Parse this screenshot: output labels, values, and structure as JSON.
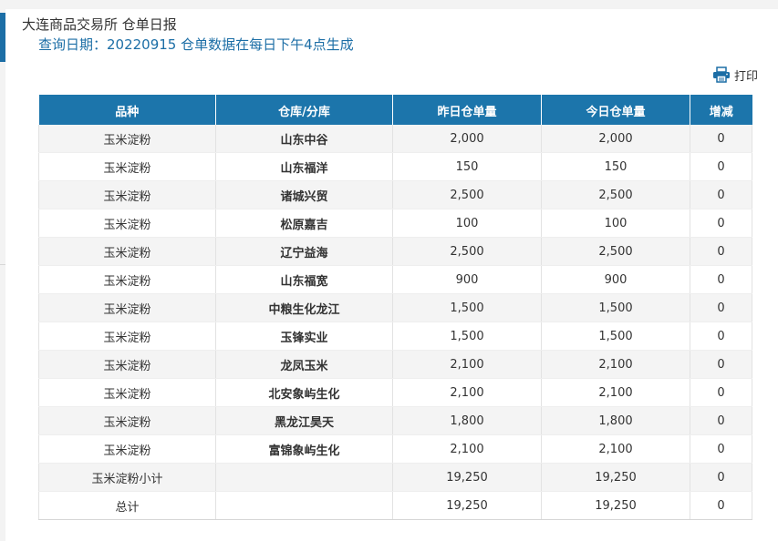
{
  "header": {
    "title": "大连商品交易所 仓单日报",
    "query_line": "查询日期：20220915 仓单数据在每日下午4点生成"
  },
  "toolbar": {
    "print_label": "打印",
    "print_icon": "printer-icon"
  },
  "table": {
    "columns": [
      "品种",
      "仓库/分库",
      "昨日仓单量",
      "今日仓单量",
      "增减"
    ],
    "rows": [
      {
        "variety": "玉米淀粉",
        "warehouse": "山东中谷",
        "yesterday": "2,000",
        "today": "2,000",
        "change": "0"
      },
      {
        "variety": "玉米淀粉",
        "warehouse": "山东福洋",
        "yesterday": "150",
        "today": "150",
        "change": "0"
      },
      {
        "variety": "玉米淀粉",
        "warehouse": "诸城兴贸",
        "yesterday": "2,500",
        "today": "2,500",
        "change": "0"
      },
      {
        "variety": "玉米淀粉",
        "warehouse": "松原嘉吉",
        "yesterday": "100",
        "today": "100",
        "change": "0"
      },
      {
        "variety": "玉米淀粉",
        "warehouse": "辽宁益海",
        "yesterday": "2,500",
        "today": "2,500",
        "change": "0"
      },
      {
        "variety": "玉米淀粉",
        "warehouse": "山东福宽",
        "yesterday": "900",
        "today": "900",
        "change": "0"
      },
      {
        "variety": "玉米淀粉",
        "warehouse": "中粮生化龙江",
        "yesterday": "1,500",
        "today": "1,500",
        "change": "0"
      },
      {
        "variety": "玉米淀粉",
        "warehouse": "玉锋实业",
        "yesterday": "1,500",
        "today": "1,500",
        "change": "0"
      },
      {
        "variety": "玉米淀粉",
        "warehouse": "龙凤玉米",
        "yesterday": "2,100",
        "today": "2,100",
        "change": "0"
      },
      {
        "variety": "玉米淀粉",
        "warehouse": "北安象屿生化",
        "yesterday": "2,100",
        "today": "2,100",
        "change": "0"
      },
      {
        "variety": "玉米淀粉",
        "warehouse": "黑龙江昊天",
        "yesterday": "1,800",
        "today": "1,800",
        "change": "0"
      },
      {
        "variety": "玉米淀粉",
        "warehouse": "富锦象屿生化",
        "yesterday": "2,100",
        "today": "2,100",
        "change": "0"
      },
      {
        "variety": "玉米淀粉小计",
        "warehouse": "",
        "yesterday": "19,250",
        "today": "19,250",
        "change": "0"
      },
      {
        "variety": "总计",
        "warehouse": "",
        "yesterday": "19,250",
        "today": "19,250",
        "change": "0"
      }
    ]
  },
  "colors": {
    "accent": "#1c75ab",
    "title_blue": "#1c6ea6",
    "row_alt": "#f4f4f4"
  }
}
